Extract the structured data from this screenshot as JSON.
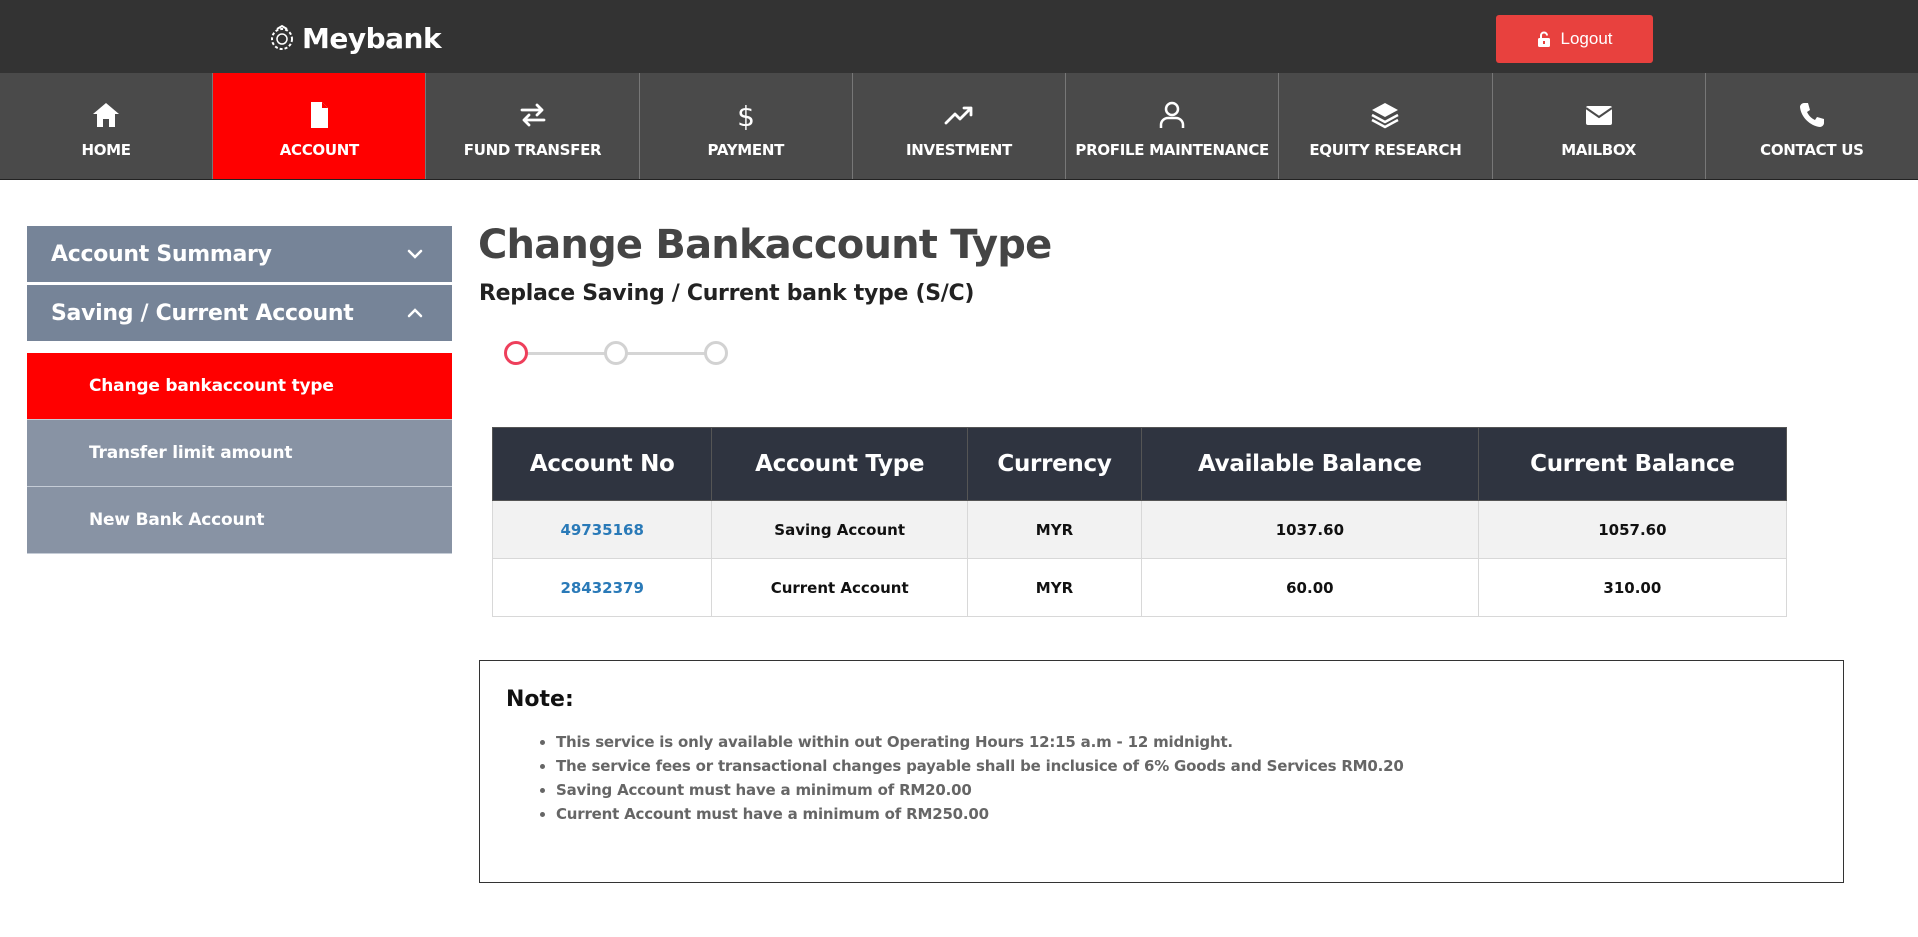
{
  "header": {
    "brand": "Meybank",
    "logout_label": "Logout"
  },
  "nav": {
    "items": [
      {
        "label": "HOME",
        "icon": "home-icon"
      },
      {
        "label": "ACCOUNT",
        "icon": "document-icon",
        "active": true
      },
      {
        "label": "FUND TRANSFER",
        "icon": "transfer-arrows-icon"
      },
      {
        "label": "PAYMENT",
        "icon": "dollar-icon"
      },
      {
        "label": "INVESTMENT",
        "icon": "trending-up-icon"
      },
      {
        "label": "PROFILE MAINTENANCE",
        "icon": "user-icon"
      },
      {
        "label": "EQUITY RESEARCH",
        "icon": "layers-icon"
      },
      {
        "label": "MAILBOX",
        "icon": "envelope-icon"
      },
      {
        "label": "CONTACT US",
        "icon": "phone-icon"
      }
    ]
  },
  "sidebar": {
    "sections": [
      {
        "label": "Account Summary",
        "icon": "chevron-down-icon"
      },
      {
        "label": "Saving / Current Account",
        "icon": "chevron-up-icon"
      }
    ],
    "items": [
      {
        "label": "Change bankaccount type",
        "active": true
      },
      {
        "label": "Transfer limit amount"
      },
      {
        "label": "New Bank Account"
      }
    ]
  },
  "main": {
    "title": "Change Bankaccount Type",
    "subtitle": "Replace Saving / Current bank type (S/C)",
    "stepper": {
      "steps": 3,
      "current": 1
    }
  },
  "table": {
    "headers": [
      "Account No",
      "Account Type",
      "Currency",
      "Available Balance",
      "Current Balance"
    ],
    "rows": [
      [
        "49735168",
        "Saving Account",
        "MYR",
        "1037.60",
        "1057.60"
      ],
      [
        "28432379",
        "Current Account",
        "MYR",
        "60.00",
        "310.00"
      ]
    ]
  },
  "note": {
    "title": "Note:",
    "items": [
      "This service is only available within out Operating Hours 12:15 a.m - 12 midnight.",
      "The service fees or transactional changes payable shall be inclusice of 6% Goods and Services RM0.20",
      "Saving Account must have a minimum of RM20.00",
      "Current Account must have a minimum of RM250.00"
    ]
  },
  "colors": {
    "topbar": "#333333",
    "nav": "#4a4a4a",
    "accent_red": "#ff0000",
    "logout": "#e8413e",
    "sidebar": "#768498",
    "table_header": "#2f3440",
    "link": "#2a7ab8"
  }
}
